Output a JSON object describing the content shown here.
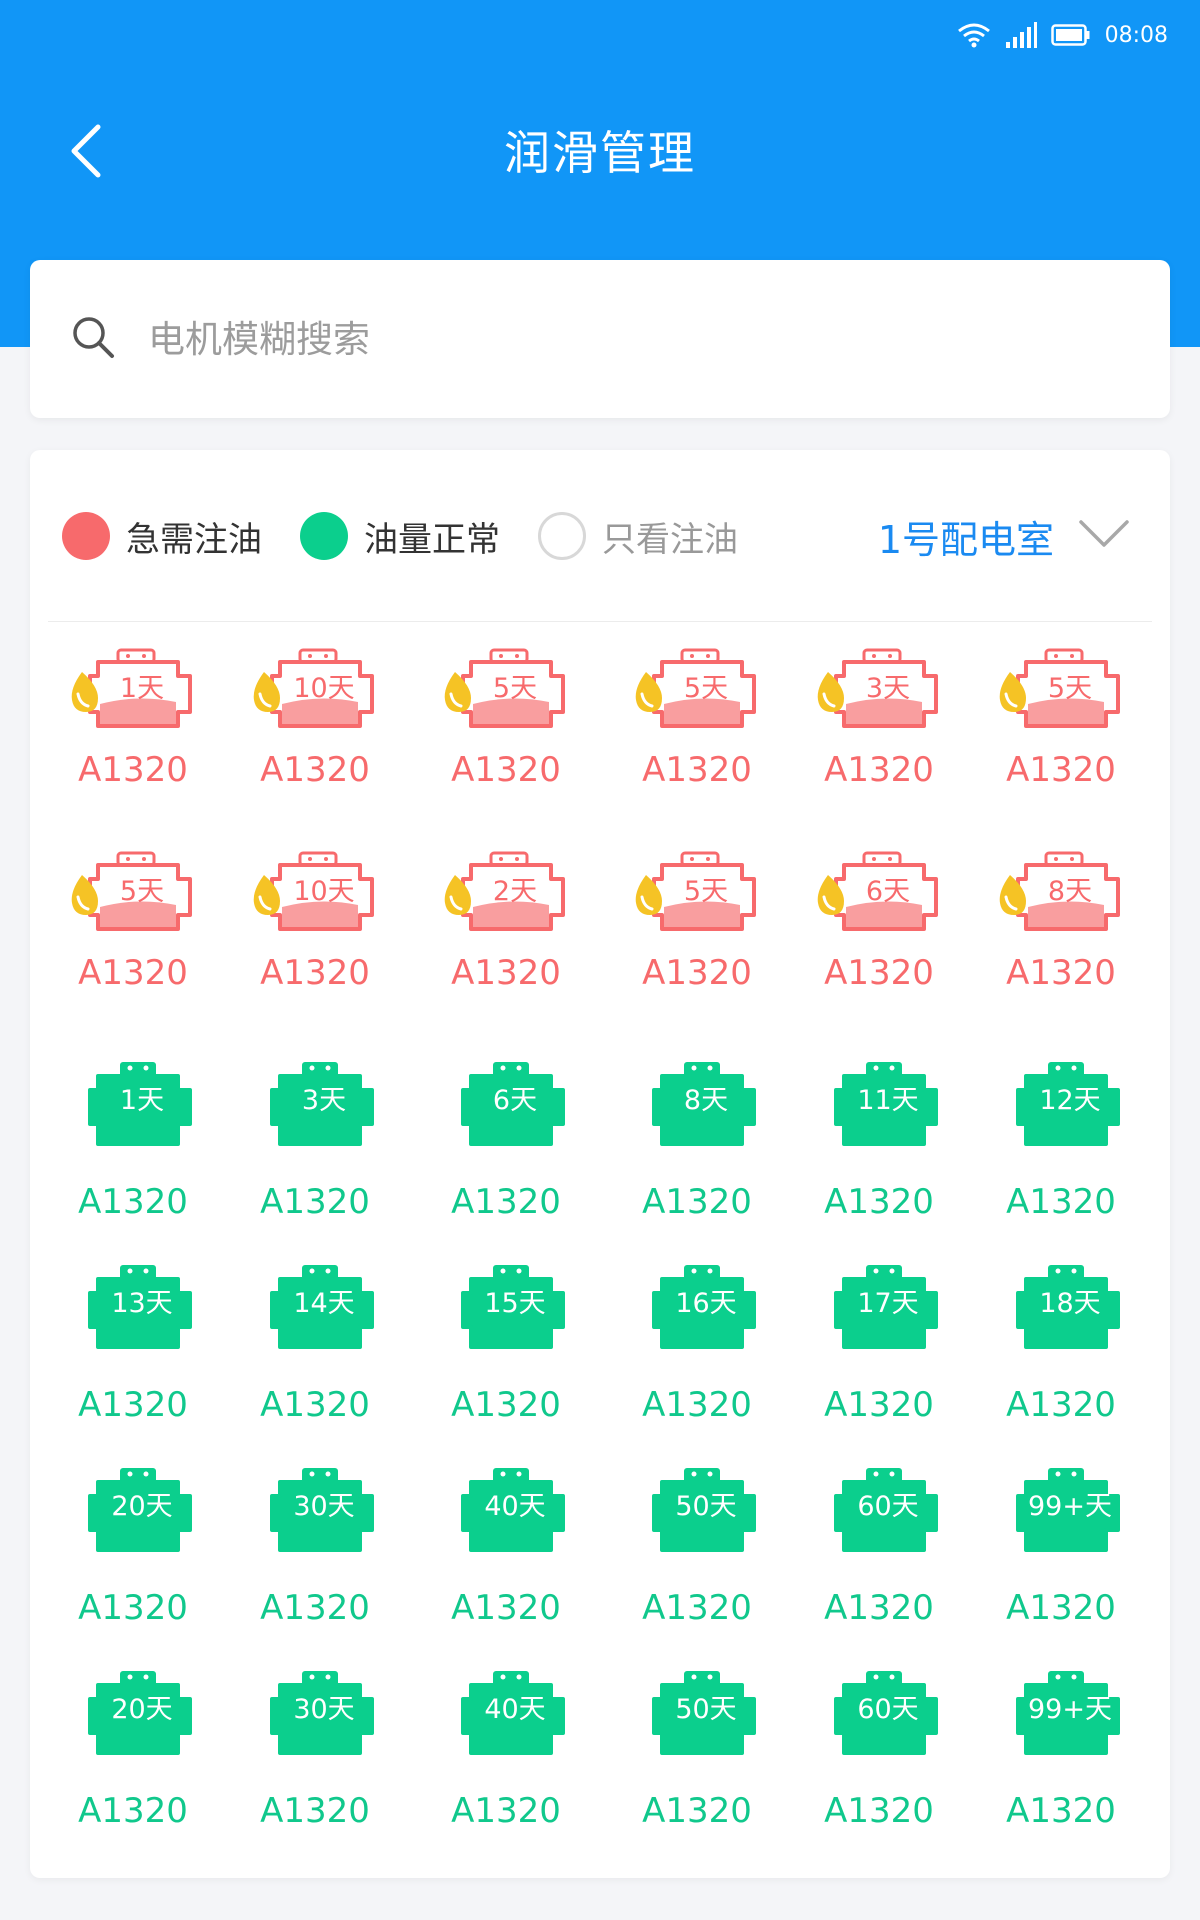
{
  "status_bar": {
    "time": "08:08"
  },
  "header": {
    "title": "润滑管理"
  },
  "search": {
    "placeholder": "电机模糊搜索"
  },
  "filters": {
    "urgent_label": "急需注油",
    "normal_label": "油量正常",
    "only_oil_label": "只看注油",
    "room_selected": "1号配电室"
  },
  "colors": {
    "primary": "#1196f7",
    "urgent": "#f76a6c",
    "normal": "#0bcf8d",
    "link": "#1a8af1"
  },
  "motors": [
    {
      "days": "1天",
      "id": "A1320",
      "status": "urgent"
    },
    {
      "days": "10天",
      "id": "A1320",
      "status": "urgent"
    },
    {
      "days": "5天",
      "id": "A1320",
      "status": "urgent"
    },
    {
      "days": "5天",
      "id": "A1320",
      "status": "urgent"
    },
    {
      "days": "3天",
      "id": "A1320",
      "status": "urgent"
    },
    {
      "days": "5天",
      "id": "A1320",
      "status": "urgent"
    },
    {
      "days": "5天",
      "id": "A1320",
      "status": "urgent"
    },
    {
      "days": "10天",
      "id": "A1320",
      "status": "urgent"
    },
    {
      "days": "2天",
      "id": "A1320",
      "status": "urgent"
    },
    {
      "days": "5天",
      "id": "A1320",
      "status": "urgent"
    },
    {
      "days": "6天",
      "id": "A1320",
      "status": "urgent"
    },
    {
      "days": "8天",
      "id": "A1320",
      "status": "urgent"
    },
    {
      "days": "1天",
      "id": "A1320",
      "status": "normal"
    },
    {
      "days": "3天",
      "id": "A1320",
      "status": "normal"
    },
    {
      "days": "6天",
      "id": "A1320",
      "status": "normal"
    },
    {
      "days": "8天",
      "id": "A1320",
      "status": "normal"
    },
    {
      "days": "11天",
      "id": "A1320",
      "status": "normal"
    },
    {
      "days": "12天",
      "id": "A1320",
      "status": "normal"
    },
    {
      "days": "13天",
      "id": "A1320",
      "status": "normal"
    },
    {
      "days": "14天",
      "id": "A1320",
      "status": "normal"
    },
    {
      "days": "15天",
      "id": "A1320",
      "status": "normal"
    },
    {
      "days": "16天",
      "id": "A1320",
      "status": "normal"
    },
    {
      "days": "17天",
      "id": "A1320",
      "status": "normal"
    },
    {
      "days": "18天",
      "id": "A1320",
      "status": "normal"
    },
    {
      "days": "20天",
      "id": "A1320",
      "status": "normal"
    },
    {
      "days": "30天",
      "id": "A1320",
      "status": "normal"
    },
    {
      "days": "40天",
      "id": "A1320",
      "status": "normal"
    },
    {
      "days": "50天",
      "id": "A1320",
      "status": "normal"
    },
    {
      "days": "60天",
      "id": "A1320",
      "status": "normal"
    },
    {
      "days": "99+天",
      "id": "A1320",
      "status": "normal"
    },
    {
      "days": "20天",
      "id": "A1320",
      "status": "normal"
    },
    {
      "days": "30天",
      "id": "A1320",
      "status": "normal"
    },
    {
      "days": "40天",
      "id": "A1320",
      "status": "normal"
    },
    {
      "days": "50天",
      "id": "A1320",
      "status": "normal"
    },
    {
      "days": "60天",
      "id": "A1320",
      "status": "normal"
    },
    {
      "days": "99+天",
      "id": "A1320",
      "status": "normal"
    }
  ]
}
